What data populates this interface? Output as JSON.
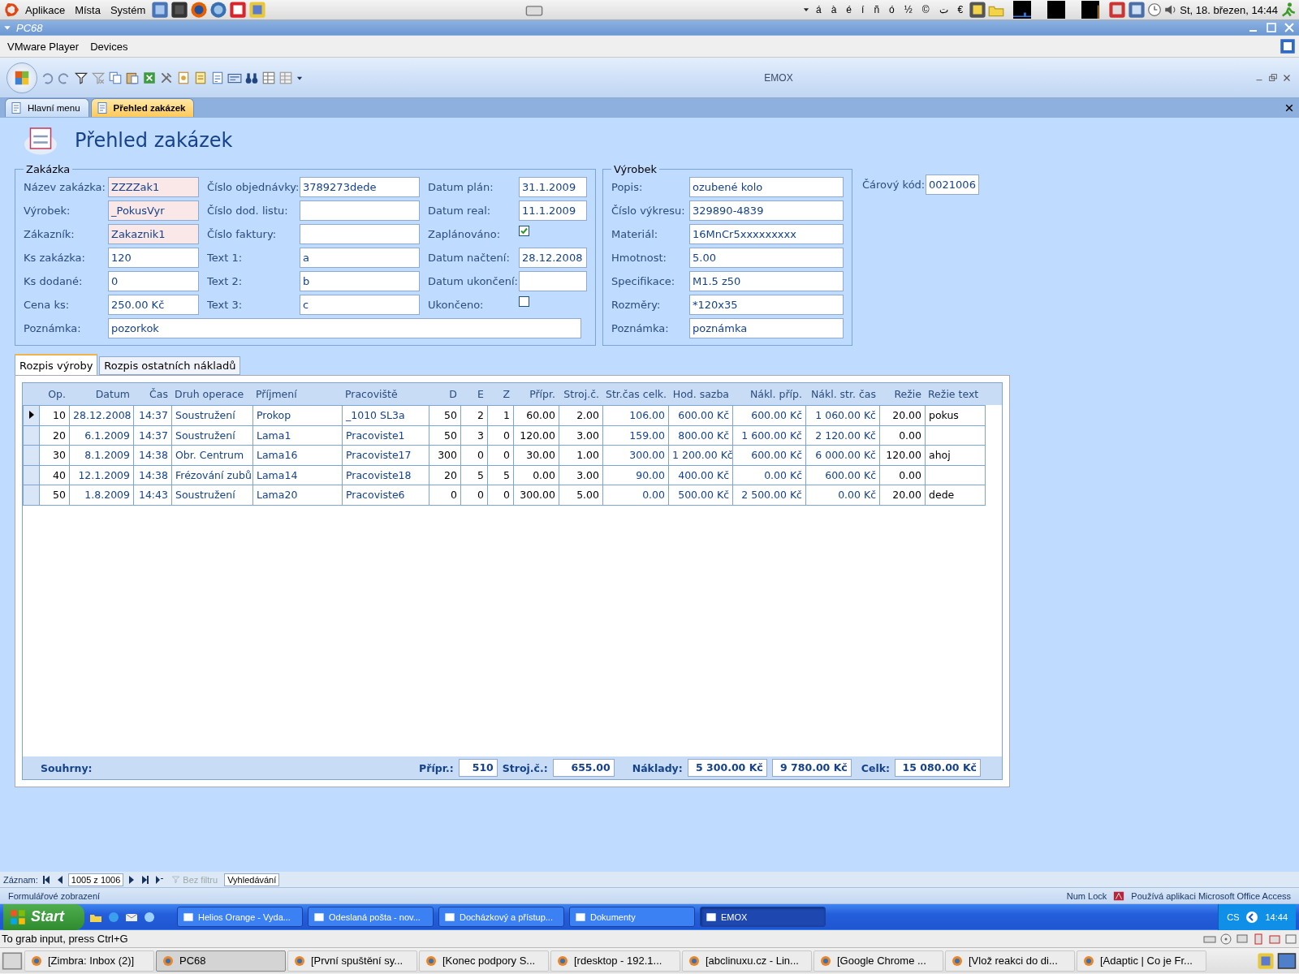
{
  "desktop_panel": {
    "menus": [
      "Aplikace",
      "Místa",
      "Systém"
    ],
    "characters": [
      "á",
      "à",
      "é",
      "í",
      "ñ",
      "ó",
      "½",
      "©",
      "ت",
      "€"
    ],
    "clock": "St, 18. březen, 14:44"
  },
  "vm_window": {
    "title": "PC68",
    "menus": [
      "VMware Player",
      "Devices"
    ]
  },
  "access": {
    "title": "EMOX",
    "document_tabs": [
      {
        "label": "Hlavní menu",
        "selected": false
      },
      {
        "label": "Přehled zakázek",
        "selected": true
      }
    ],
    "form": {
      "title": "Přehled zakázek",
      "zakazka": {
        "title": "Zakázka",
        "columns": [
          [
            {
              "label": "Název zakázka:",
              "value": "ZZZZak1",
              "kind": "text",
              "highlighted": true
            },
            {
              "label": "Výrobek:",
              "value": "_PokusVyr",
              "kind": "text",
              "highlighted": true
            },
            {
              "label": "Zákazník:",
              "value": "Zakaznik1",
              "kind": "text",
              "highlighted": true
            },
            {
              "label": "Ks zakázka:",
              "value": "120",
              "kind": "text",
              "highlighted": false
            },
            {
              "label": "Ks dodané:",
              "value": "0",
              "kind": "text",
              "highlighted": false
            },
            {
              "label": "Cena ks:",
              "value": "250.00 Kč",
              "kind": "text",
              "highlighted": false
            }
          ],
          [
            {
              "label": "Číslo objednávky:",
              "value": "3789273dede",
              "kind": "text"
            },
            {
              "label": "Číslo dod. listu:",
              "kind": "text"
            },
            {
              "label": "Číslo faktury:",
              "kind": "text"
            },
            {
              "label": "Text 1:",
              "value": "a",
              "kind": "text"
            },
            {
              "label": "Text 2:",
              "value": "b",
              "kind": "text"
            },
            {
              "label": "Text 3:",
              "value": "c",
              "kind": "text"
            }
          ],
          [
            {
              "label": "Datum plán:",
              "value": "31.1.2009",
              "kind": "text"
            },
            {
              "label": "Datum real:",
              "value": "11.1.2009",
              "kind": "text"
            },
            {
              "label": "Zaplánováno:",
              "kind": "checkbox",
              "checked": true
            },
            {
              "label": "Datum načtení:",
              "value": "28.12.2008",
              "kind": "text"
            },
            {
              "label": "Datum ukončení:",
              "kind": "text"
            },
            {
              "label": "Ukončeno:",
              "kind": "checkbox",
              "checked": false
            }
          ]
        ],
        "note": {
          "label": "Poznámka:",
          "value": "pozorkok"
        }
      },
      "vyrobek": {
        "title": "Výrobek",
        "fields": [
          {
            "label": "Popis:",
            "value": "ozubené kolo"
          },
          {
            "label": "Číslo výkresu:",
            "value": "329890-4839"
          },
          {
            "label": "Materiál:",
            "value": "16MnCr5xxxxxxxxx"
          },
          {
            "label": "Hmotnost:",
            "value": "5.00"
          },
          {
            "label": "Specifikace:",
            "value": "M1.5 z50"
          },
          {
            "label": "Rozměry:",
            "value": "*120x35"
          },
          {
            "label": "Poznámka:",
            "value": "poznámka"
          }
        ]
      },
      "barcode": {
        "label": "Čárový kód:",
        "value": "0021006"
      },
      "subtabs": [
        {
          "label": "Rozpis výroby",
          "selected": true
        },
        {
          "label": "Rozpis ostatních nákladů",
          "selected": false
        }
      ],
      "table": {
        "columns": [
          {
            "label": "Op.",
            "kind": "number",
            "locked": false
          },
          {
            "label": "Datum",
            "kind": "number",
            "locked": true
          },
          {
            "label": "Čas",
            "kind": "number",
            "locked": true
          },
          {
            "label": "Druh operace",
            "kind": "text",
            "locked": true
          },
          {
            "label": "Příjmení",
            "kind": "text",
            "locked": true
          },
          {
            "label": "Pracoviště",
            "kind": "text",
            "locked": true
          },
          {
            "label": "D",
            "kind": "number",
            "locked": false
          },
          {
            "label": "E",
            "kind": "number",
            "locked": false
          },
          {
            "label": "Z",
            "kind": "number",
            "locked": false
          },
          {
            "label": "Přípr.",
            "kind": "number",
            "locked": false
          },
          {
            "label": "Stroj.č.",
            "kind": "number",
            "locked": false
          },
          {
            "label": "Str.čas celk.",
            "kind": "number",
            "locked": true
          },
          {
            "label": "Hod. sazba",
            "kind": "number",
            "locked": true
          },
          {
            "label": "Nákl. příp.",
            "kind": "number",
            "locked": true
          },
          {
            "label": "Nákl. str. čas",
            "kind": "number",
            "locked": true
          },
          {
            "label": "Režie",
            "kind": "number",
            "locked": false
          },
          {
            "label": "Režie text",
            "kind": "text",
            "locked": false
          }
        ],
        "rows": [
          {
            "current": true,
            "cells": [
              "10",
              "28.12.2008",
              "14:37",
              "Soustružení",
              "Prokop",
              "_1010 SL3a",
              "50",
              "2",
              "1",
              "60.00",
              "2.00",
              "106.00",
              "600.00 Kč",
              "600.00 Kč",
              "1 060.00 Kč",
              "20.00",
              "pokus"
            ]
          },
          {
            "current": false,
            "cells": [
              "20",
              "6.1.2009",
              "14:37",
              "Soustružení",
              "Lama1",
              "Pracoviste1",
              "50",
              "3",
              "0",
              "120.00",
              "3.00",
              "159.00",
              "800.00 Kč",
              "1 600.00 Kč",
              "2 120.00 Kč",
              "0.00",
              ""
            ]
          },
          {
            "current": false,
            "cells": [
              "30",
              "8.1.2009",
              "14:38",
              "Obr. Centrum",
              "Lama16",
              "Pracoviste17",
              "300",
              "0",
              "0",
              "30.00",
              "1.00",
              "300.00",
              "1 200.00 Kč",
              "600.00 Kč",
              "6 000.00 Kč",
              "120.00",
              "ahoj"
            ]
          },
          {
            "current": false,
            "cells": [
              "40",
              "12.1.2009",
              "14:38",
              "Frézování zubů",
              "Lama14",
              "Pracoviste18",
              "20",
              "5",
              "5",
              "0.00",
              "3.00",
              "90.00",
              "400.00 Kč",
              "0.00 Kč",
              "600.00 Kč",
              "0.00",
              ""
            ]
          },
          {
            "current": false,
            "cells": [
              "50",
              "1.8.2009",
              "14:43",
              "Soustružení",
              "Lama20",
              "Pracoviste6",
              "0",
              "0",
              "0",
              "300.00",
              "5.00",
              "0.00",
              "500.00 Kč",
              "2 500.00 Kč",
              "0.00 Kč",
              "20.00",
              "dede"
            ]
          }
        ]
      },
      "summary": {
        "label": "Souhrny:",
        "items": [
          {
            "label": "Přípr.:",
            "value": "510"
          },
          {
            "label": "Stroj.č.:",
            "value": "655.00"
          },
          {
            "label": "Náklady:",
            "value": "5 300.00 Kč"
          },
          {
            "value": "9 780.00 Kč"
          },
          {
            "label": "Celk:",
            "value": "15 080.00 Kč"
          }
        ]
      }
    },
    "record_nav": {
      "label": "Záznam:",
      "position": "1005 z 1006",
      "filter": {
        "label": "Bez filtru",
        "disabled": true
      },
      "search": "Vyhledávání"
    },
    "status_bar": {
      "view": "Formulářové zobrazení",
      "num_lock": "Num Lock",
      "app": "Používá aplikaci Microsoft Office Access"
    }
  },
  "xp_taskbar": {
    "start": "Start",
    "tasks": [
      {
        "label": "Helios Orange - Vyda...",
        "selected": false
      },
      {
        "label": "Odeslaná pošta - nov...",
        "selected": false
      },
      {
        "label": "Docházkový a přístup...",
        "selected": false
      },
      {
        "label": "Dokumenty",
        "selected": false
      },
      {
        "label": "EMOX",
        "selected": true
      }
    ],
    "language": "CS",
    "clock": "14:44"
  },
  "vm_status": "To grab input, press Ctrl+G",
  "host_taskbar": [
    {
      "label": "[Zimbra: Inbox (2)]",
      "selected": false
    },
    {
      "label": "PC68",
      "selected": true
    },
    {
      "label": "[První spuštění sy...",
      "selected": false
    },
    {
      "label": "[Konec podpory S...",
      "selected": false
    },
    {
      "label": "[rdesktop - 192.1...",
      "selected": false
    },
    {
      "label": "[abclinuxu.cz - Lin...",
      "selected": false
    },
    {
      "label": "[Google Chrome ...",
      "selected": false
    },
    {
      "label": "[Vlož reakci do di...",
      "selected": false
    },
    {
      "label": "[Adaptic | Co je Fr...",
      "selected": false
    }
  ]
}
